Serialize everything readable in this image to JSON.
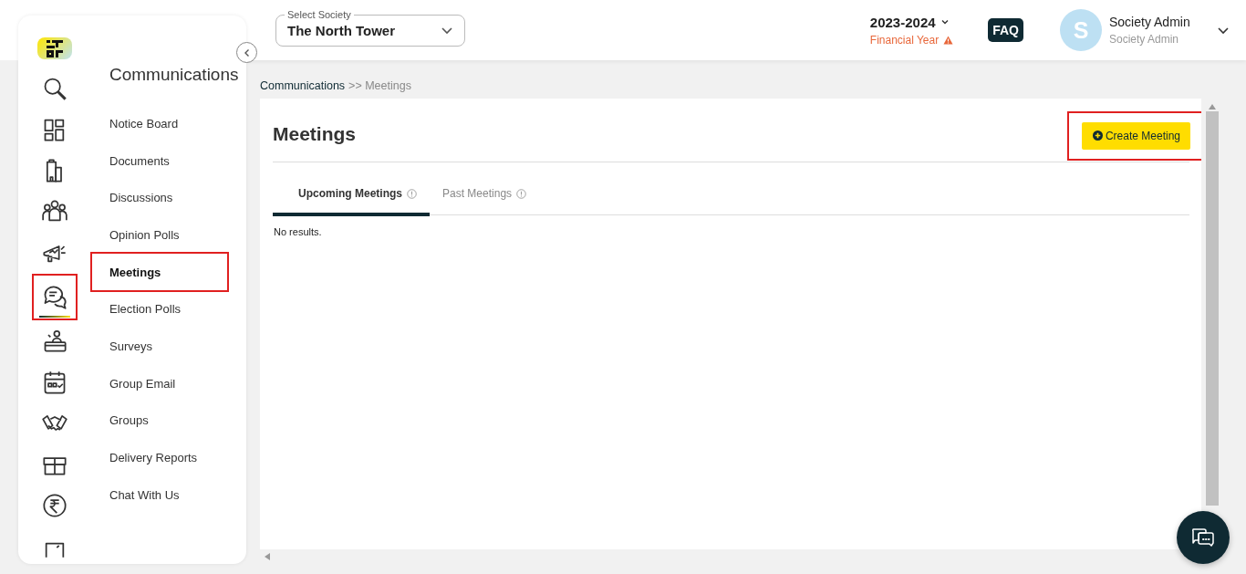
{
  "rail": [
    {
      "selected": false,
      "highlighted": false
    },
    {
      "selected": false,
      "highlighted": false
    },
    {
      "selected": false,
      "highlighted": false
    },
    {
      "selected": false,
      "highlighted": false
    },
    {
      "selected": false,
      "highlighted": false
    },
    {
      "selected": true,
      "highlighted": true
    },
    {
      "selected": false,
      "highlighted": false
    },
    {
      "selected": false,
      "highlighted": false
    },
    {
      "selected": false,
      "highlighted": false
    },
    {
      "selected": false,
      "highlighted": false
    },
    {
      "selected": false,
      "highlighted": false
    },
    {
      "selected": false,
      "highlighted": false
    }
  ],
  "menu": {
    "title": "Communications",
    "items": [
      {
        "label": "Notice Board",
        "selected": false,
        "highlighted": false
      },
      {
        "label": "Documents",
        "selected": false,
        "highlighted": false
      },
      {
        "label": "Discussions",
        "selected": false,
        "highlighted": false
      },
      {
        "label": "Opinion Polls",
        "selected": false,
        "highlighted": false
      },
      {
        "label": "Meetings",
        "selected": true,
        "highlighted": true
      },
      {
        "label": "Election Polls",
        "selected": false,
        "highlighted": false
      },
      {
        "label": "Surveys",
        "selected": false,
        "highlighted": false
      },
      {
        "label": "Group Email",
        "selected": false,
        "highlighted": false
      },
      {
        "label": "Groups",
        "selected": false,
        "highlighted": false
      },
      {
        "label": "Delivery Reports",
        "selected": false,
        "highlighted": false
      },
      {
        "label": "Chat With Us",
        "selected": false,
        "highlighted": false
      }
    ]
  },
  "header": {
    "society_select": {
      "label": "Select Society",
      "value": "The North Tower"
    },
    "year": "2023-2024",
    "year_note": "Financial Year",
    "faq": "FAQ",
    "user": {
      "initial": "S",
      "name": "Society Admin",
      "role": "Society Admin"
    }
  },
  "breadcrumb": [
    {
      "label": "Communications",
      "kind": "link"
    },
    {
      "label": ">> Meetings",
      "kind": "current"
    }
  ],
  "page": {
    "title": "Meetings",
    "create_button": {
      "label": "Create Meeting",
      "highlighted": true
    },
    "tabs": [
      {
        "label": "Upcoming Meetings",
        "selected": true
      },
      {
        "label": "Past Meetings",
        "selected": false
      }
    ],
    "empty_text": "No results."
  }
}
